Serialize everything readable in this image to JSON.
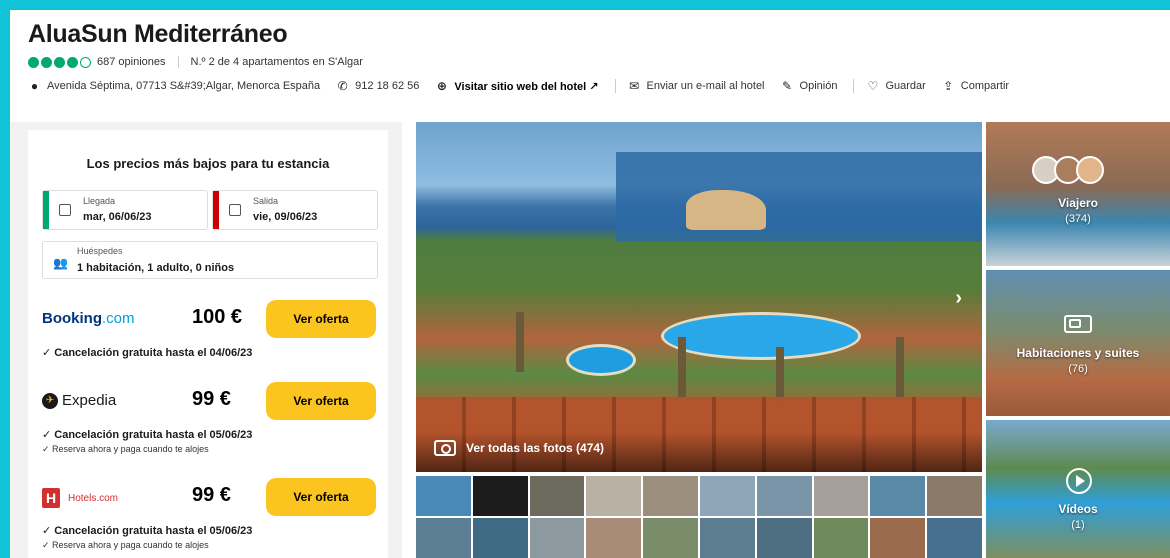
{
  "hotel": {
    "name": "AluaSun Mediterráneo",
    "rating_bubbles": 4,
    "rating_max": 5,
    "reviews": "687 opiniones",
    "rank": "N.º 2 de 4 apartamentos en S'Algar",
    "address": "Avenida Séptima, 07713 S&#39;Algar, Menorca España",
    "phone": "912 18 62 56",
    "website": "Visitar sitio web del hotel ↗",
    "email": "Enviar un e-mail al hotel",
    "review_action": "Opinión",
    "save_action": "Guardar",
    "share_action": "Compartir"
  },
  "colors": {
    "brand_green": "#00aa6c",
    "offer_button": "#fcc41f",
    "checkin_bar": "#00aa6c",
    "checkout_bar": "#cc0000",
    "page_frame": "#12c3d8"
  },
  "booking": {
    "title": "Los precios más bajos para tu estancia",
    "checkin_label": "Llegada",
    "checkin_value": "mar, 06/06/23",
    "checkout_label": "Salida",
    "checkout_value": "vie, 09/06/23",
    "guests_label": "Huéspedes",
    "guests_value": "1 habitación, 1 adulto, 0 niños",
    "offers": [
      {
        "provider": "Booking",
        "provider_suffix": ".com",
        "price": "100 €",
        "button": "Ver oferta",
        "cancel": "Cancelación gratuita hasta el 04/06/23",
        "note": ""
      },
      {
        "provider": "Expedia",
        "price": "99 €",
        "button": "Ver oferta",
        "cancel": "Cancelación gratuita hasta el 05/06/23",
        "note": "Reserva ahora y paga cuando te alojes"
      },
      {
        "provider": "Hotels.com",
        "provider_mark": "H",
        "price": "99 €",
        "button": "Ver oferta",
        "cancel": "Cancelación gratuita hasta el 05/06/23",
        "note": "Reserva ahora y paga cuando te alojes"
      }
    ]
  },
  "gallery": {
    "view_all": "Ver todas las fotos (474)",
    "side": [
      {
        "label": "Viajero",
        "count": "(374)",
        "icon": "traveler-avatars-icon"
      },
      {
        "label": "Habitaciones y suites",
        "count": "(76)",
        "icon": "bed-icon"
      },
      {
        "label": "Vídeos",
        "count": "(1)",
        "icon": "play-icon"
      }
    ]
  }
}
